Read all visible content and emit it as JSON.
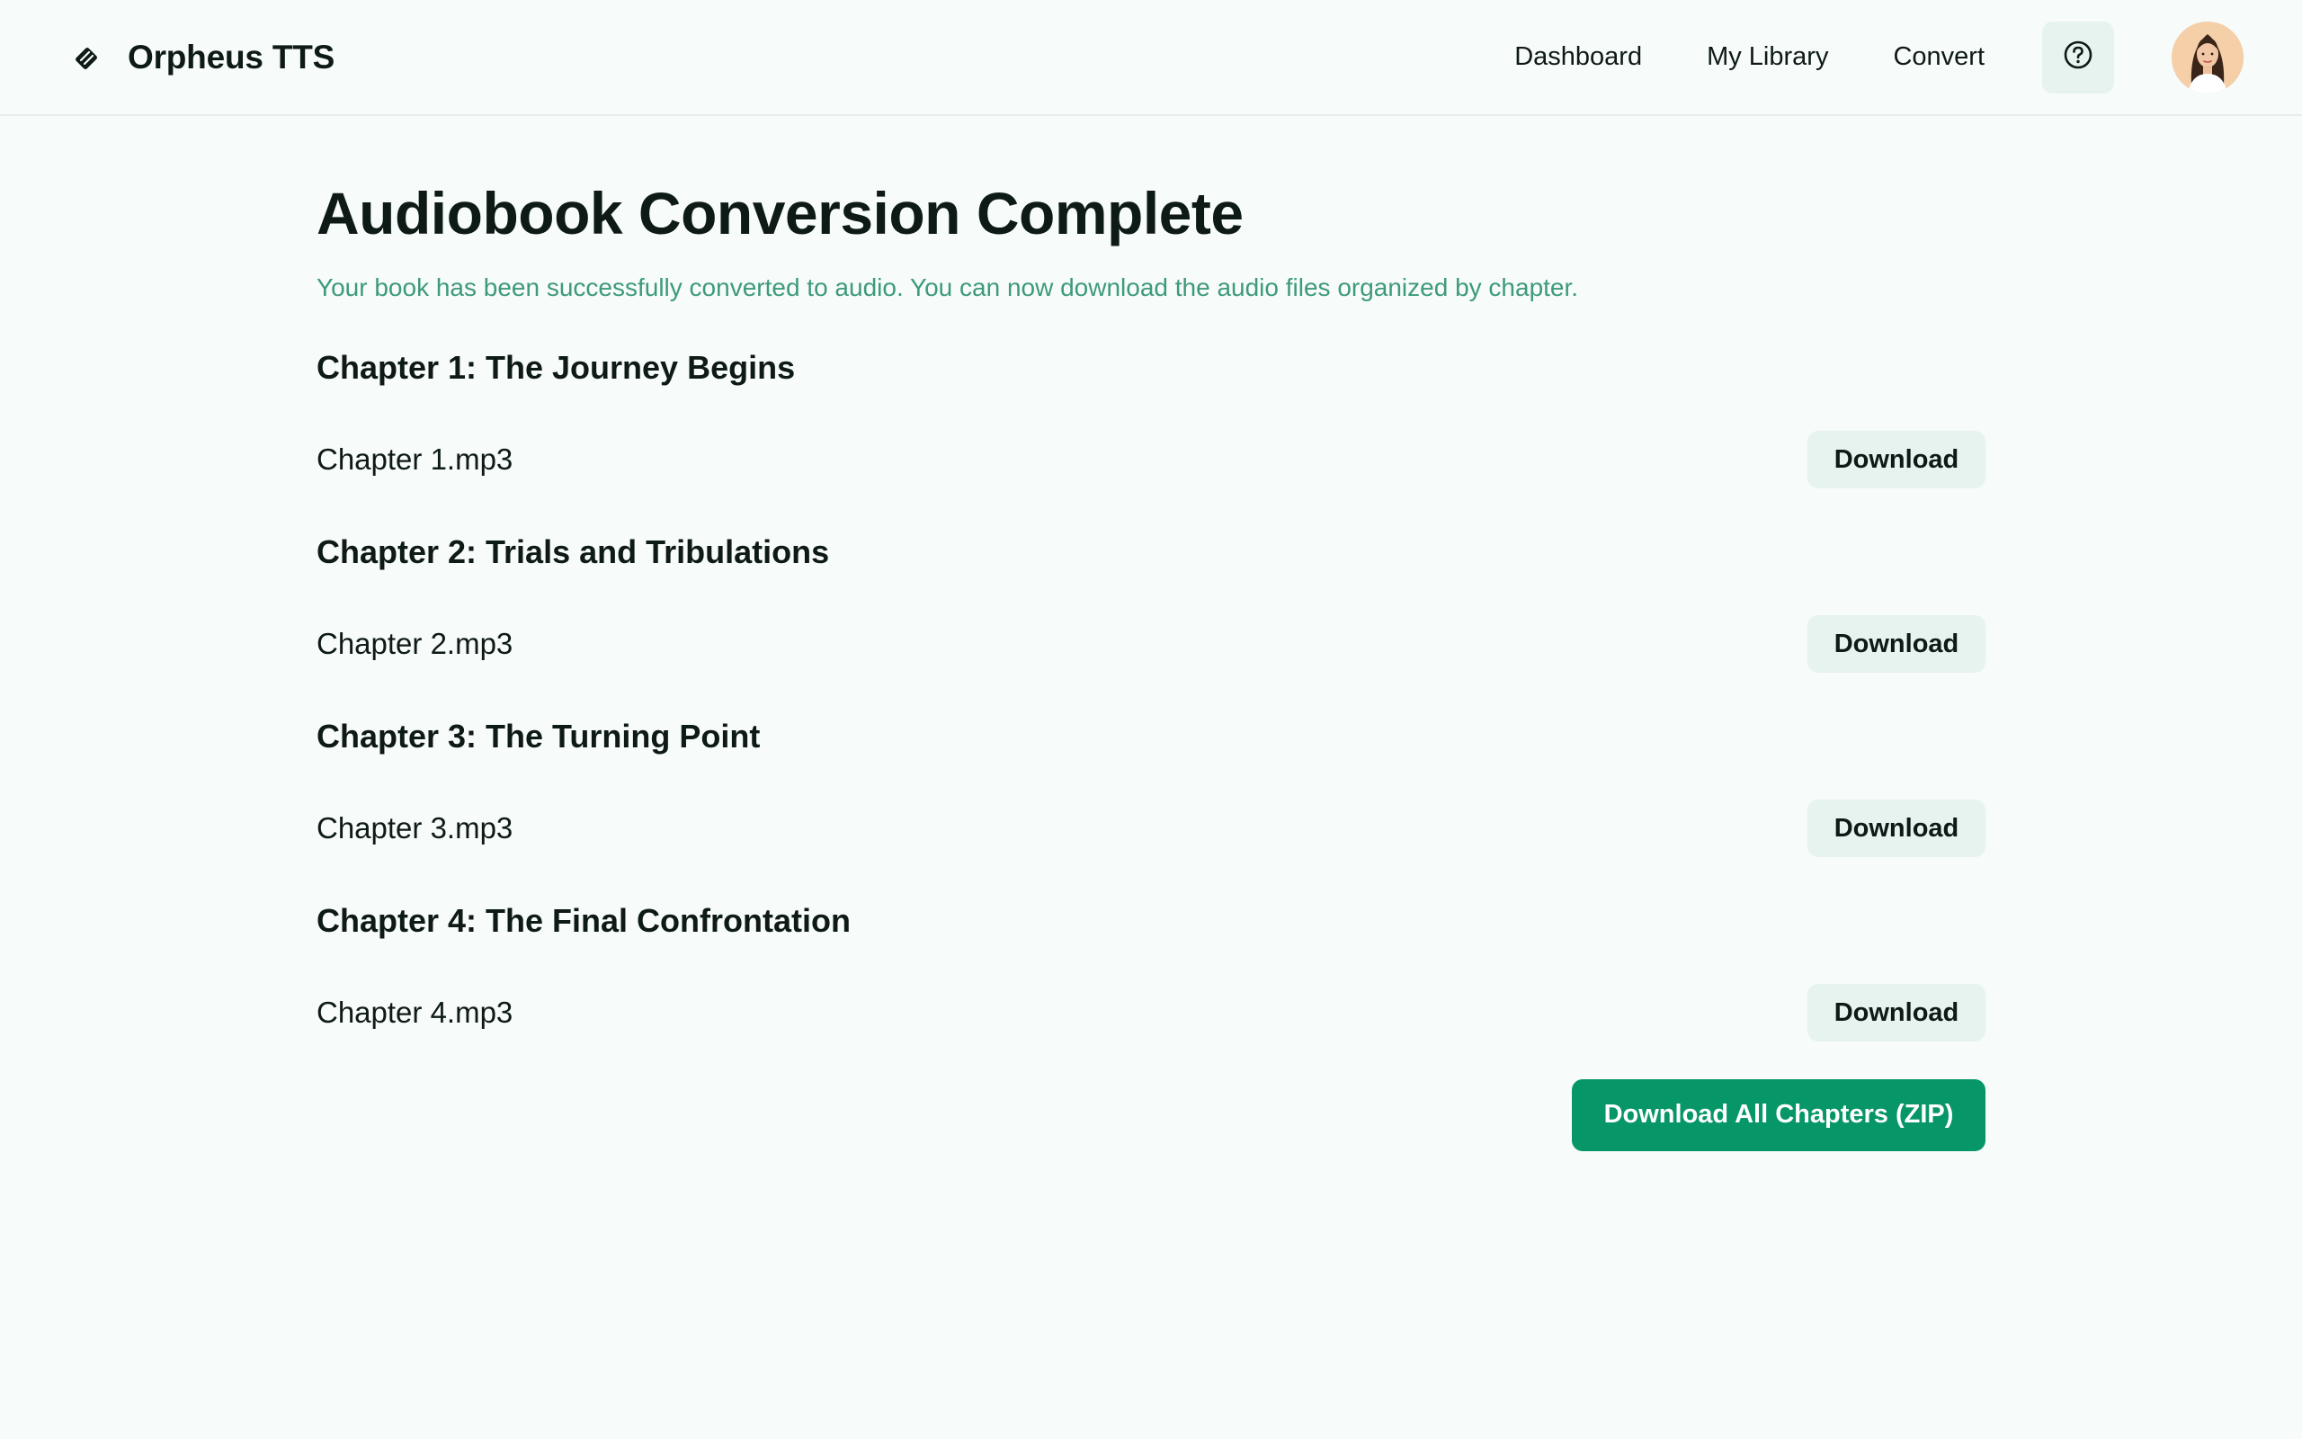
{
  "header": {
    "brand": "Orpheus TTS",
    "brand_icon": "book-logo-icon",
    "nav": [
      {
        "label": "Dashboard"
      },
      {
        "label": "My Library"
      },
      {
        "label": "Convert"
      }
    ],
    "help_icon": "help-circle-icon"
  },
  "main": {
    "title": "Audiobook Conversion Complete",
    "subtitle": "Your book has been successfully converted to audio. You can now download the audio files organized by chapter.",
    "chapters": [
      {
        "title": "Chapter 1: The Journey Begins",
        "file": "Chapter 1.mp3",
        "action": "Download"
      },
      {
        "title": "Chapter 2: Trials and Tribulations",
        "file": "Chapter 2.mp3",
        "action": "Download"
      },
      {
        "title": "Chapter 3: The Turning Point",
        "file": "Chapter 3.mp3",
        "action": "Download"
      },
      {
        "title": "Chapter 4: The Final Confrontation",
        "file": "Chapter 4.mp3",
        "action": "Download"
      }
    ],
    "download_all_label": "Download All Chapters (ZIP)"
  },
  "colors": {
    "background": "#f7fbfa",
    "accent": "#079667",
    "subtitle": "#3d9a7c",
    "button_bg": "#e6f3ef"
  }
}
